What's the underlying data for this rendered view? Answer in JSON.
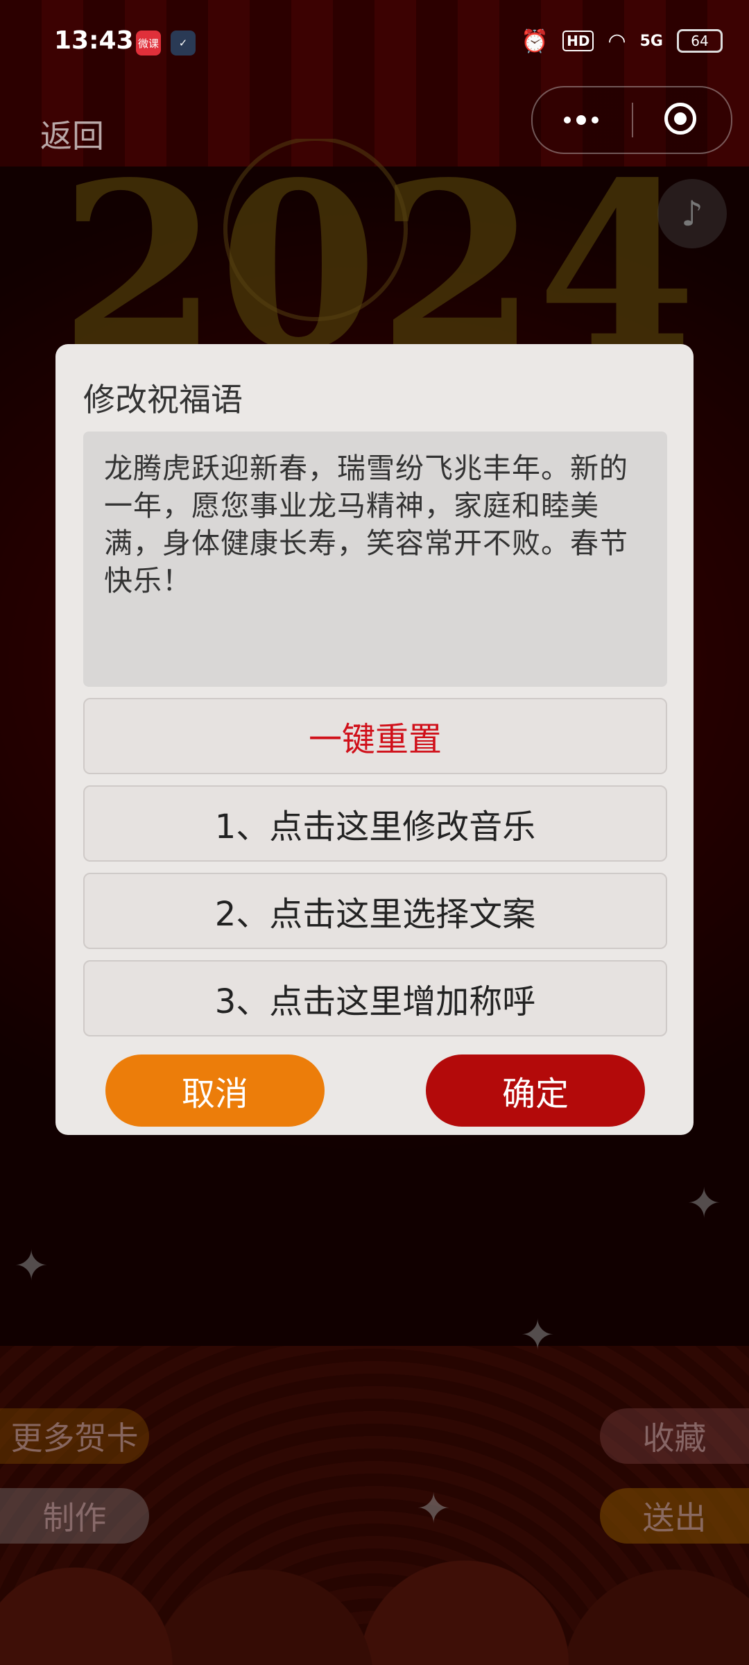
{
  "status_bar": {
    "time": "13:43",
    "app_icons": [
      "微课",
      "✓"
    ],
    "battery": "64",
    "network": "5G",
    "hd": "HD"
  },
  "nav": {
    "back_label": "返回"
  },
  "background": {
    "year_text": "2024"
  },
  "dialog": {
    "title": "修改祝福语",
    "message": "龙腾虎跃迎新春，瑞雪纷飞兆丰年。新的一年，愿您事业龙马精神，家庭和睦美满，身体健康长寿，笑容常开不败。春节快乐！",
    "reset_label": "一键重置",
    "option1": "1、点击这里修改音乐",
    "option2": "2、点击这里选择文案",
    "option3": "3、点击这里增加称呼",
    "cancel_label": "取消",
    "confirm_label": "确定"
  },
  "side_buttons": {
    "more_cards": "更多贺卡",
    "make": "制作",
    "favorite": "收藏",
    "send": "送出"
  },
  "colors": {
    "reset_text": "#d0101a",
    "cancel_bg": "#ec7d0a",
    "confirm_bg": "#b30a0a",
    "dialog_bg": "#ebe8e6"
  }
}
